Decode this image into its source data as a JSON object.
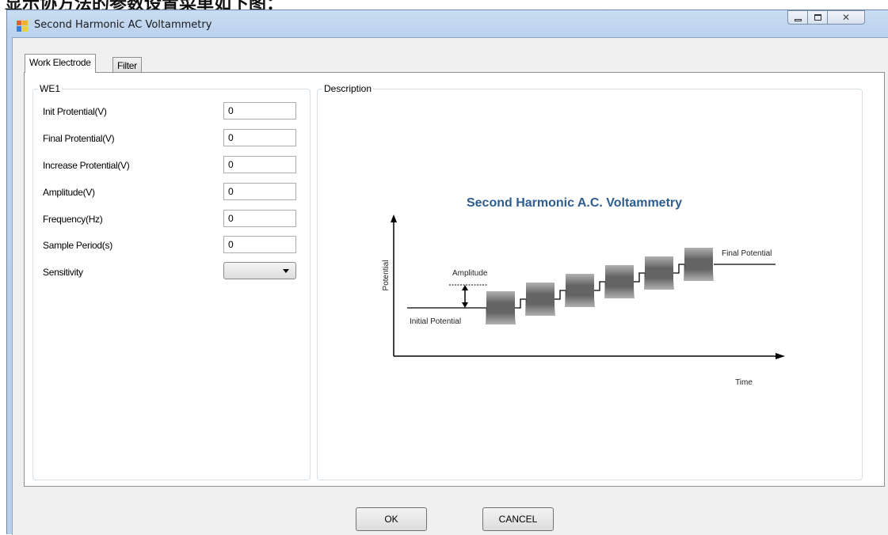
{
  "document_caption": "显示协方法的参数设置菜单如下图：",
  "window": {
    "title": "Second Harmonic AC Voltammetry",
    "controls": {
      "minimize_icon": "minimize-icon",
      "maximize_icon": "maximize-icon",
      "close_icon": "close-icon"
    }
  },
  "tabs": [
    {
      "label": "Work Electrode",
      "selected": true
    },
    {
      "label": "Filter",
      "selected": false
    }
  ],
  "we_group": {
    "title": "WE1",
    "fields": [
      {
        "label": "Init Protential(V)",
        "value": "0"
      },
      {
        "label": "Final Protential(V)",
        "value": "0"
      },
      {
        "label": "Increase Protential(V)",
        "value": "0"
      },
      {
        "label": "Amplitude(V)",
        "value": "0"
      },
      {
        "label": "Frequency(Hz)",
        "value": "0"
      },
      {
        "label": "Sample Period(s)",
        "value": "0"
      }
    ],
    "sensitivity": {
      "label": "Sensitivity",
      "value": ""
    }
  },
  "description": {
    "title": "Description",
    "diagram": {
      "title": "Second Harmonic A.C. Voltammetry",
      "y_label": "Potential",
      "x_label": "Time",
      "amplitude_label": "Amplitude",
      "initial_label": "Initial Potential",
      "final_label": "Final Potential",
      "title_color": "#2e5d8e"
    }
  },
  "buttons": {
    "ok": "OK",
    "cancel": "CANCEL"
  }
}
